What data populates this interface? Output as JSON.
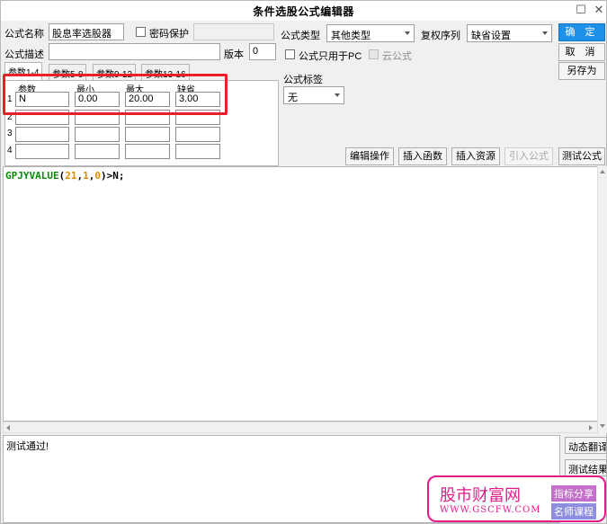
{
  "window": {
    "title": "条件选股公式编辑器",
    "minimize_glyph": "☐",
    "close_glyph": "✕"
  },
  "form": {
    "name_label": "公式名称",
    "name_value": "股息率选股器",
    "password_label": "密码保护",
    "password_checked": false,
    "type_label": "公式类型",
    "type_value": "其他类型",
    "adjust_label": "复权序列",
    "adjust_value": "缺省设置",
    "desc_label": "公式描述",
    "desc_value": "",
    "version_label": "版本",
    "version_value": "0",
    "pc_only_label": "公式只用于PC",
    "pc_only_checked": false,
    "cloud_label": "云公式",
    "cloud_checked": false,
    "tag_label": "公式标签",
    "tag_value": "无"
  },
  "buttons": {
    "ok": "确 定",
    "cancel": "取 消",
    "save_as": "另存为",
    "edit_ops": "编辑操作",
    "insert_func": "插入函数",
    "insert_res": "插入资源",
    "import_formula": "引入公式",
    "test_formula": "测试公式"
  },
  "tabs": [
    {
      "label": "参数1-4",
      "active": true
    },
    {
      "label": "参数5-8",
      "active": false
    },
    {
      "label": "参数9-12",
      "active": false
    },
    {
      "label": "参数13-16",
      "active": false
    }
  ],
  "params": {
    "headers": [
      "参数",
      "最小",
      "最大",
      "缺省"
    ],
    "rows": [
      {
        "num": "1",
        "name": "N",
        "min": "0.00",
        "max": "20.00",
        "default": "3.00"
      },
      {
        "num": "2",
        "name": "",
        "min": "",
        "max": "",
        "default": ""
      },
      {
        "num": "3",
        "name": "",
        "min": "",
        "max": "",
        "default": ""
      },
      {
        "num": "4",
        "name": "",
        "min": "",
        "max": "",
        "default": ""
      }
    ]
  },
  "editor": {
    "code_fn": "GPJYVALUE",
    "code_open": "(",
    "code_arg1": "21",
    "code_comma1": ",",
    "code_arg2": "1",
    "code_comma2": ",",
    "code_arg3": "0",
    "code_close": ")>N;"
  },
  "result": {
    "text": "测试通过!",
    "dynamic_translate": "动态翻译",
    "test_result": "测试结果"
  },
  "watermark": {
    "brand": "股市财富网",
    "url": "WWW.GSCFW.COM",
    "tag1": "指标分享",
    "tag2": "名师课程"
  },
  "colors": {
    "primary_button": "#1e90e8",
    "highlight_box": "#e8202a",
    "code_function": "#0a8a0a",
    "code_number": "#e08a00",
    "watermark": "#e31a8a"
  }
}
